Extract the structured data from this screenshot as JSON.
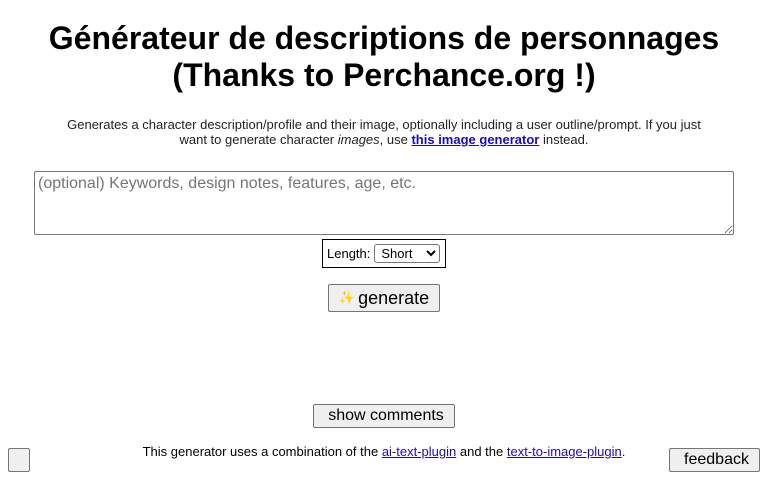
{
  "header": {
    "title_line1": "Générateur de descriptions de personnages",
    "title_line2": "(Thanks to Perchance.org !)"
  },
  "intro": {
    "text_before": "Generates a character description/profile and their image, optionally including a user outline/prompt. If you just want to generate character ",
    "emphasis": "images",
    "text_middle": ", use ",
    "link_label": "this image generator",
    "text_after": " instead."
  },
  "keywords_input": {
    "placeholder": "(optional) Keywords, design notes, features, age, etc.",
    "value": ""
  },
  "length_selector": {
    "label": "Length:",
    "selected": "Short"
  },
  "generate_button": {
    "icon": "sparkles-icon",
    "glyph": "✨",
    "label": "generate"
  },
  "comments_button": {
    "glyph": "",
    "label": "show comments"
  },
  "footer": {
    "text_before": "This generator uses a combination of the ",
    "link1_label": "ai-text-plugin",
    "text_middle": " and the ",
    "link2_label": "text-to-image-plugin",
    "text_after": "."
  },
  "corner_button": {
    "glyph": ""
  },
  "feedback_button": {
    "glyph": "",
    "label": "feedback"
  }
}
